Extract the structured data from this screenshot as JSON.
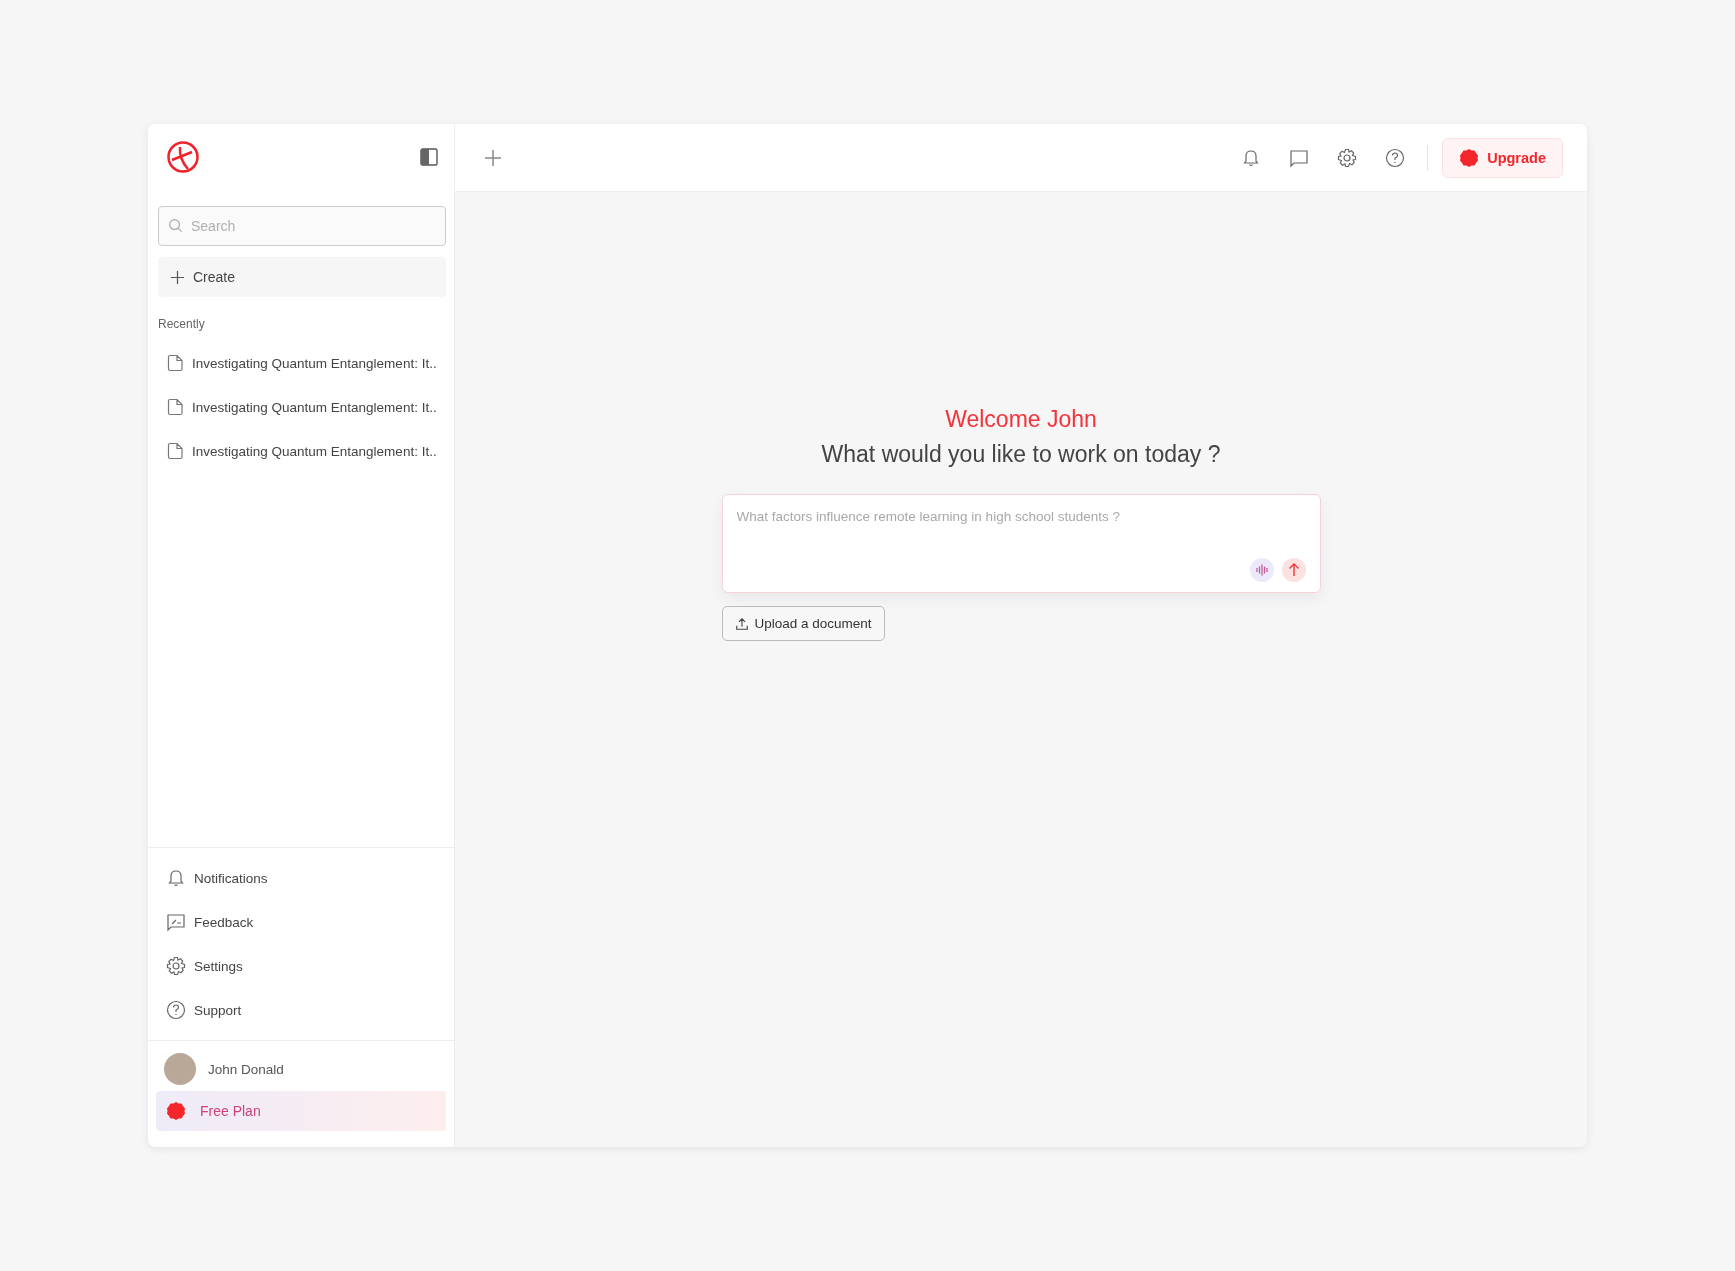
{
  "sidebar": {
    "search": {
      "placeholder": "Search"
    },
    "create_label": "Create",
    "section_title": "Recently",
    "recent": [
      {
        "title": "Investigating Quantum Entanglement: It.."
      },
      {
        "title": "Investigating Quantum Entanglement: It.."
      },
      {
        "title": "Investigating Quantum Entanglement: It.."
      }
    ],
    "nav": [
      {
        "kind": "notifications",
        "label": "Notifications"
      },
      {
        "kind": "feedback",
        "label": "Feedback"
      },
      {
        "kind": "settings",
        "label": "Settings"
      },
      {
        "kind": "support",
        "label": "Support"
      }
    ],
    "user": {
      "name": "John Donald"
    },
    "plan": "Free Plan"
  },
  "topbar": {
    "icons": [
      {
        "kind": "notifications"
      },
      {
        "kind": "chat"
      },
      {
        "kind": "settings"
      },
      {
        "kind": "help"
      }
    ],
    "upgrade_label": "Upgrade"
  },
  "main": {
    "welcome": "Welcome John",
    "question": "What would you like to work on today ?",
    "prompt": {
      "placeholder": "What factors influence remote learning in high school students ?"
    },
    "upload_label": "Upload a document"
  }
}
